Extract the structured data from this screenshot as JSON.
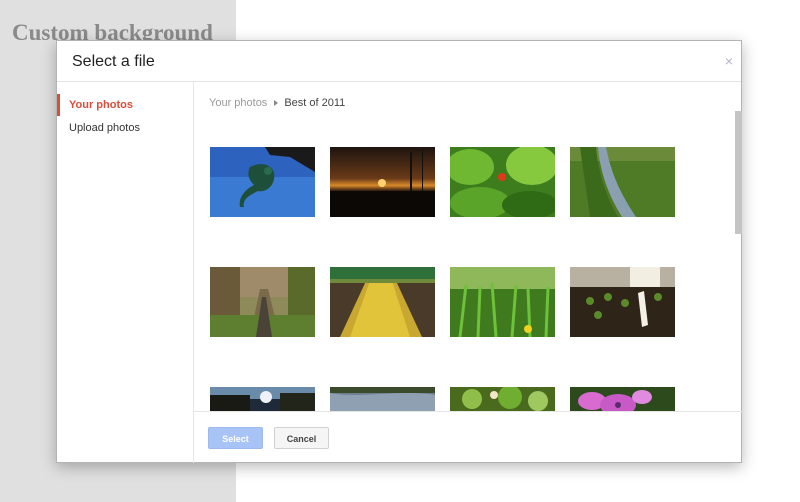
{
  "page": {
    "background_heading": "Custom background"
  },
  "dialog": {
    "title": "Select a file",
    "close_label": "×",
    "sidebar": {
      "items": [
        {
          "label": "Your photos",
          "active": true
        },
        {
          "label": "Upload photos",
          "active": false
        }
      ]
    },
    "breadcrumb": {
      "root": "Your photos",
      "current": "Best of 2011"
    },
    "photos": [
      {
        "subject": "gargoyle against blue sky"
      },
      {
        "subject": "sunset"
      },
      {
        "subject": "green leaves with ladybug"
      },
      {
        "subject": "stream in grass"
      },
      {
        "subject": "overgrown railway track"
      },
      {
        "subject": "vineyard rows"
      },
      {
        "subject": "green horsetail plants"
      },
      {
        "subject": "seedlings in soil with label"
      },
      {
        "subject": "dark trees with sunlight"
      },
      {
        "subject": "water reflection"
      },
      {
        "subject": "green plants"
      },
      {
        "subject": "pink flowers"
      }
    ],
    "buttons": {
      "select": "Select",
      "cancel": "Cancel"
    }
  },
  "colors": {
    "accent_red": "#dd4b39",
    "select_button": "#a8c3f5",
    "left_panel": "#e0e0e0"
  }
}
